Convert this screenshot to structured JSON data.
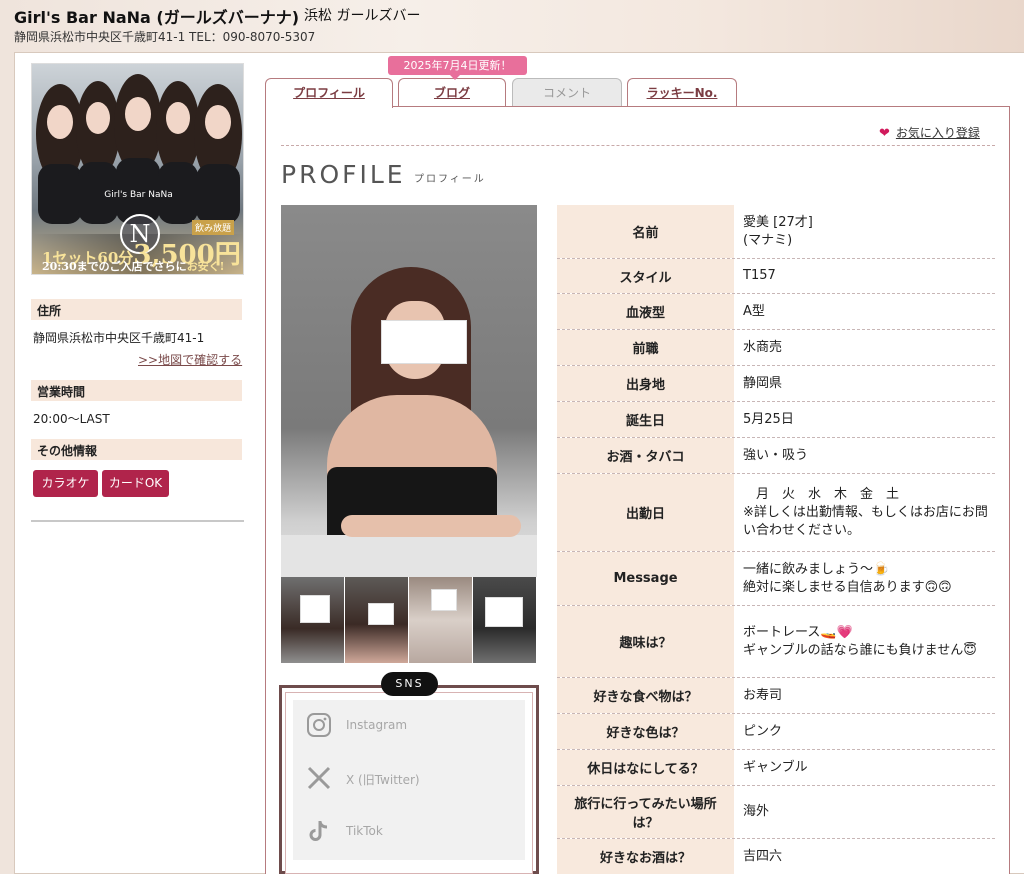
{
  "header": {
    "title": "Girl's Bar NaNa (ガールズバーナナ)",
    "subtitle": "浜松 ガールズバー",
    "address_line": "静岡県浜松市中央区千歳町41-1  TEL：090-8070-5307"
  },
  "banner": {
    "logo_letter": "N",
    "logo_text": "Girl's Bar NaNa",
    "nomi_label": "飲み放題",
    "price_prefix": "1セット60分",
    "price": "3,500円",
    "early_text": "20:30までのご入店でさらに",
    "early_highlight": "お安く!"
  },
  "sidebar": {
    "address_heading": "住所",
    "address": "静岡県浜松市中央区千歳町41-1",
    "map_link": ">>地図で確認する",
    "hours_heading": "営業時間",
    "hours": "20:00〜LAST",
    "other_heading": "その他情報",
    "tags": [
      "カラオケ",
      "カードOK"
    ]
  },
  "tabs": {
    "update_badge": "2025年7月4日更新！",
    "items": [
      {
        "label": "プロフィール",
        "state": "active"
      },
      {
        "label": "ブログ",
        "state": "normal"
      },
      {
        "label": "コメント",
        "state": "disabled"
      },
      {
        "label": "ラッキーNo.",
        "state": "normal"
      }
    ]
  },
  "favorite_label": "お気に入り登録",
  "profile": {
    "title": "PROFILE",
    "title_jp": "プロフィール",
    "rows": [
      {
        "key": "名前",
        "value": "愛美 [27才]\n(マナミ)"
      },
      {
        "key": "スタイル",
        "value": "T157"
      },
      {
        "key": "血液型",
        "value": "A型"
      },
      {
        "key": "前職",
        "value": "水商売"
      },
      {
        "key": "出身地",
        "value": "静岡県"
      },
      {
        "key": "誕生日",
        "value": "5月25日"
      },
      {
        "key": "お酒・タバコ",
        "value": "強い・吸う"
      },
      {
        "key": "出勤日",
        "value": "　月　火　水　木　金　土\n※詳しくは出勤情報、もしくはお店にお問い合わせください。"
      },
      {
        "key": "Message",
        "value": "一緒に飲みましょう〜🍺\n絶対に楽しませる自信あります🙃🙃"
      },
      {
        "key": "趣味は？",
        "value": "ボートレース🚤💗\nギャンブルの話なら誰にも負けません😇"
      },
      {
        "key": "好きな食べ物は？",
        "value": "お寿司"
      },
      {
        "key": "好きな色は？",
        "value": "ピンク"
      },
      {
        "key": "休日はなにしてる？",
        "value": "ギャンブル"
      },
      {
        "key": "旅行に行ってみたい場所は？",
        "value": "海外"
      },
      {
        "key": "好きなお酒は？",
        "value": "吉四六"
      }
    ]
  },
  "sns": {
    "label": "SNS",
    "items": [
      {
        "icon": "instagram-icon",
        "label": "Instagram"
      },
      {
        "icon": "x-icon",
        "label": "X (旧Twitter)"
      },
      {
        "icon": "tiktok-icon",
        "label": "TikTok"
      }
    ]
  },
  "colors": {
    "accent": "#b0244b",
    "tab_border": "#b67b7f",
    "key_bg": "#f8e9dd",
    "badge": "#e86f9b"
  }
}
